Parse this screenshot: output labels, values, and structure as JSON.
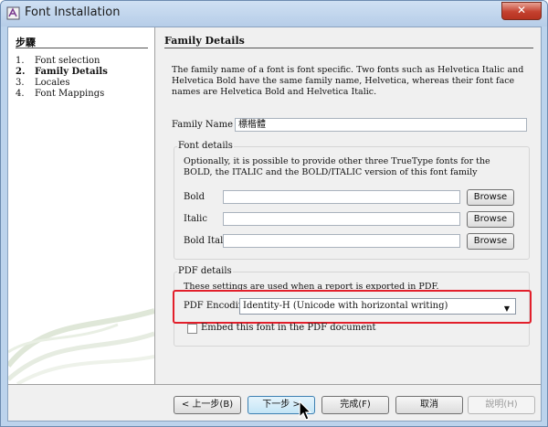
{
  "window": {
    "title": "Font Installation",
    "close_label": "✕"
  },
  "steps": {
    "title": "步驟",
    "items": [
      {
        "num": "1.",
        "label": "Font selection",
        "current": false
      },
      {
        "num": "2.",
        "label": "Family Details",
        "current": true
      },
      {
        "num": "3.",
        "label": "Locales",
        "current": false
      },
      {
        "num": "4.",
        "label": "Font Mappings",
        "current": false
      }
    ]
  },
  "main": {
    "title": "Family Details",
    "description": "The family name of a font is font specific. Two fonts such as Helvetica Italic and Helvetica Bold have the same family name, Helvetica, whereas their font face names are Helvetica Bold and Helvetica Italic.",
    "family_name": {
      "label": "Family Name",
      "value": "標楷體"
    },
    "font_details": {
      "title": "Font details",
      "description": "Optionally, it is possible to provide other three TrueType fonts for the BOLD, the ITALIC and the BOLD/ITALIC version of this font family",
      "rows": [
        {
          "label": "Bold",
          "value": "",
          "button": "Browse"
        },
        {
          "label": "Italic",
          "value": "",
          "button": "Browse"
        },
        {
          "label": "Bold Italic",
          "value": "",
          "button": "Browse"
        }
      ]
    },
    "pdf_details": {
      "title": "PDF details",
      "description": "These settings are used when a report is exported in PDF.",
      "encoding_label": "PDF Encoding",
      "encoding_value": "Identity-H (Unicode with horizontal writing)",
      "embed_label": "Embed this font in the PDF document",
      "embed_checked": false
    }
  },
  "footer": {
    "back": "< 上一步(B)",
    "next": "下一步 >",
    "finish": "完成(F)",
    "cancel": "取消",
    "help": "說明(H)"
  },
  "colors": {
    "highlight": "#e21f2b",
    "close_button": "#c4412f"
  }
}
